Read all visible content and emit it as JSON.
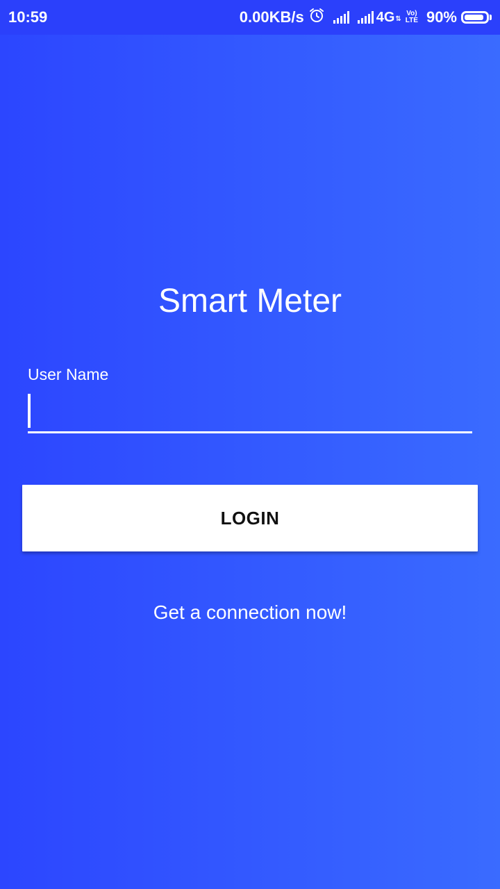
{
  "status_bar": {
    "time": "10:59",
    "net_speed": "0.00KB/s",
    "alarm_icon": "alarm-clock-icon",
    "network_type": "4G",
    "network_arrows": "⇅",
    "volte_top": "Vo)",
    "volte_bottom": "LTE",
    "battery_percent": "90%",
    "battery_level": 0.9
  },
  "app": {
    "title": "Smart Meter",
    "username_label": "User Name",
    "username_value": "",
    "login_label": "LOGIN",
    "connect_link": "Get a connection now!"
  },
  "colors": {
    "background_start": "#2c46ff",
    "background_end": "#3a6bff",
    "status_bar": "#2b40fb",
    "button_bg": "#ffffff",
    "button_text": "#111111"
  }
}
